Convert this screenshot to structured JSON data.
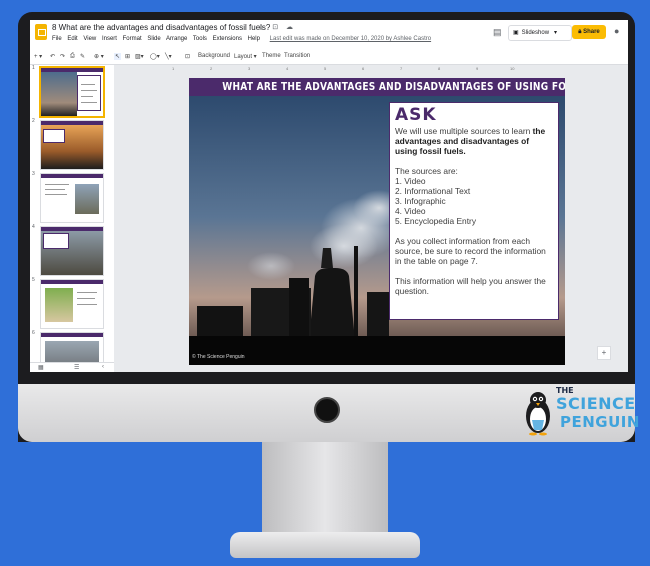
{
  "doc": {
    "title": "8 What are the advantages and disadvantages of fossil fuels?",
    "title_icons": "☆ ⊡ ☁",
    "menus": [
      "File",
      "Edit",
      "View",
      "Insert",
      "Format",
      "Slide",
      "Arrange",
      "Tools",
      "Extensions",
      "Help"
    ],
    "last_edit": "Last edit was made on December 10, 2020 by Ashlee Castro"
  },
  "header": {
    "slideshow_label": "Slideshow",
    "share_label": "Share"
  },
  "toolbar": {
    "background_label": "Background",
    "layout_label": "Layout ▾",
    "theme_label": "Theme",
    "transition_label": "Transition"
  },
  "ruler": [
    "1",
    "2",
    "3",
    "4",
    "5",
    "6",
    "7",
    "8",
    "9",
    "10"
  ],
  "filmstrip": {
    "numbers": [
      "1",
      "2",
      "3",
      "4",
      "5",
      "6"
    ]
  },
  "slide": {
    "banner": "WHAT ARE THE ADVANTAGES AND DISADVANTAGES OF USING FOSSIL FUELS?",
    "heading": "ASK",
    "intro_plain": "We will use multiple sources to learn ",
    "intro_bold": "the advantages and disadvantages of using fossil fuels.",
    "sources_label": "The sources are:",
    "sources": [
      "1.  Video",
      "2.  Informational Text",
      "3.  Infographic",
      "4.  Video",
      "5.  Encyclopedia Entry"
    ],
    "collect_text": "As you collect information from each source, be sure to record the information in the table on page 7.",
    "help_text": "This information will help you answer the question.",
    "credit": "© The Science Penguin"
  },
  "brand": {
    "the": "THE",
    "science": "SCIENCE",
    "penguin": "PENGUIN"
  },
  "colors": {
    "background": "#2f6fd8",
    "banner": "#4b2a6b",
    "share": "#fbbc04",
    "brand": "#3fa3dc"
  }
}
